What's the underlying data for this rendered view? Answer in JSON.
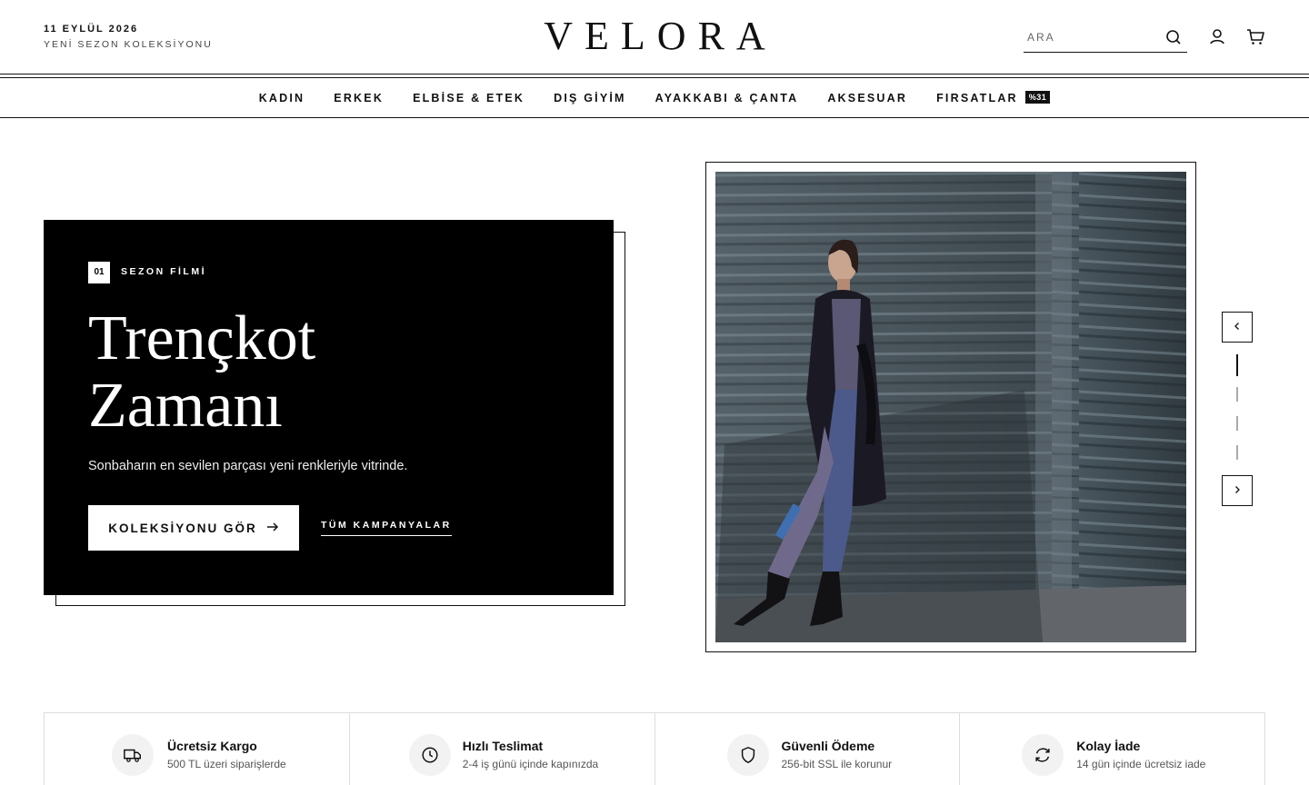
{
  "header": {
    "date": "11 EYLÜL 2026",
    "season": "YENİ SEZON KOLEKSİYONU",
    "logo": "VELORA",
    "search_placeholder": "ARA"
  },
  "nav": {
    "items": [
      "KADIN",
      "ERKEK",
      "ELBİSE & ETEK",
      "DIŞ GİYİM",
      "AYAKKABI & ÇANTA",
      "AKSESUAR",
      "FIRSATLAR"
    ],
    "badge": "%31"
  },
  "hero": {
    "number": "01",
    "tag": "SEZON FİLMİ",
    "title_line1": "Trençkot",
    "title_line2": "Zamanı",
    "subtitle": "Sonbaharın en sevilen parçası yeni renkleriyle vitrinde.",
    "primary_button": "KOLEKSİYONU GÖR",
    "secondary_link": "TÜM KAMPANYALAR"
  },
  "slider": {
    "total": 4,
    "active_index": 0
  },
  "features": [
    {
      "icon": "truck-icon",
      "title": "Ücretsiz Kargo",
      "desc": "500 TL üzeri siparişlerde"
    },
    {
      "icon": "clock-icon",
      "title": "Hızlı Teslimat",
      "desc": "2-4 iş günü içinde kapınızda"
    },
    {
      "icon": "shield-icon",
      "title": "Güvenli Ödeme",
      "desc": "256-bit SSL ile korunur"
    },
    {
      "icon": "refresh-icon",
      "title": "Kolay İade",
      "desc": "14 gün içinde ücretsiz iade"
    }
  ],
  "colors": {
    "primary": "#111111",
    "background": "#ffffff",
    "hero_bg": "#000000"
  }
}
